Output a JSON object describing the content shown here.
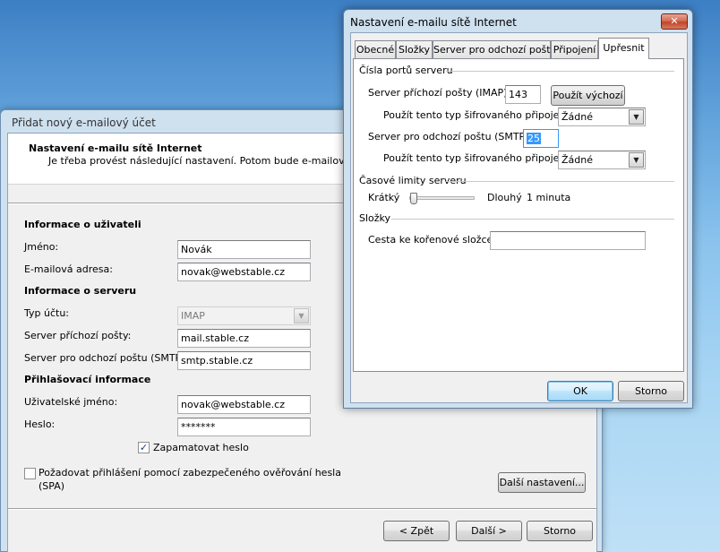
{
  "wizard": {
    "title": "Přidat nový e-mailový účet",
    "header_title": "Nastavení e-mailu sítě Internet",
    "header_subtitle": "Je třeba provést následující nastavení. Potom bude e-mailový účet fu",
    "user_section": "Informace o uživateli",
    "name_label": "Jméno:",
    "name_value": "Novák",
    "email_label": "E-mailová adresa:",
    "email_value": "novak@webstable.cz",
    "server_section": "Informace o serveru",
    "account_type_label": "Typ účtu:",
    "account_type_value": "IMAP",
    "incoming_label": "Server příchozí pošty:",
    "incoming_value": "mail.stable.cz",
    "outgoing_label": "Server pro odchozí poštu (SMTP):",
    "outgoing_value": "smtp.stable.cz",
    "login_section": "Přihlašovací informace",
    "username_label": "Uživatelské jméno:",
    "username_value": "novak@webstable.cz",
    "password_label": "Heslo:",
    "password_value": "*******",
    "remember_label": "Zapamatovat heslo",
    "remember_checked": true,
    "spa_label_line1": "Požadovat přihlášení pomocí zabezpečeného ověřování hesla",
    "spa_label_line2": "(SPA)",
    "spa_checked": false,
    "more_settings_button": "Další nastavení...",
    "back_button": "< Zpět",
    "next_button": "Další >",
    "cancel_button": "Storno"
  },
  "dialog": {
    "title": "Nastavení e-mailu sítě Internet",
    "close_glyph": "✕",
    "tabs": [
      {
        "label": "Obecné",
        "active": false
      },
      {
        "label": "Složky",
        "active": false
      },
      {
        "label": "Server pro odchozí poštu",
        "active": false
      },
      {
        "label": "Připojení",
        "active": false
      },
      {
        "label": "Upřesnit",
        "active": true
      }
    ],
    "ports_group": "Čísla portů serveru",
    "imap_label": "Server příchozí pošty (IMAP):",
    "imap_port": "143",
    "use_default_button": "Použít výchozí",
    "encryption_label_1": "Použít tento typ šifrovaného připojení:",
    "encryption_value_1": "Žádné",
    "smtp_label": "Server pro odchozí poštu (SMTP):",
    "smtp_port": "25",
    "encryption_label_2": "Použít tento typ šifrovaného připojení:",
    "encryption_value_2": "Žádné",
    "timeout_group": "Časové limity serveru",
    "short_label": "Krátký",
    "long_label": "Dlouhý",
    "timeout_value": "1 minuta",
    "timeout_level": 0.02,
    "folders_group": "Složky",
    "root_path_label": "Cesta ke kořenové složce:",
    "root_path_value": "",
    "ok_button": "OK",
    "cancel_button": "Storno"
  }
}
